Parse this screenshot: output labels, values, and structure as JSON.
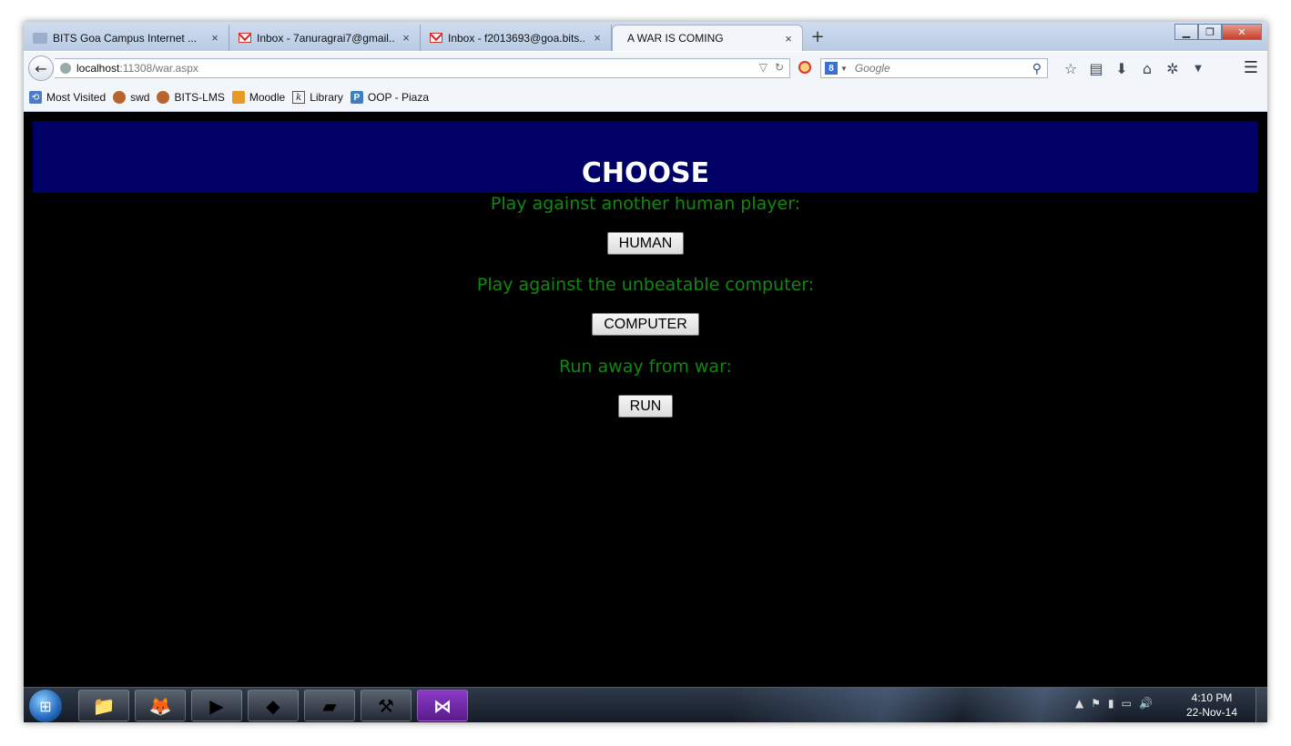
{
  "browser": {
    "tabs": [
      {
        "title": "BITS Goa Campus Internet ...",
        "icon": "network-icon",
        "active": false
      },
      {
        "title": "Inbox - 7anuragrai7@gmail...",
        "icon": "gmail-icon",
        "active": false
      },
      {
        "title": "Inbox - f2013693@goa.bits...",
        "icon": "gmail-icon",
        "active": false
      },
      {
        "title": "A WAR IS COMING",
        "icon": "",
        "active": true
      }
    ],
    "close_glyph": "×",
    "new_tab_glyph": "+",
    "url_host": "localhost",
    "url_path": ":11308/war.aspx",
    "search_engine_glyph": "8",
    "search_placeholder": "Google",
    "bookmarks": [
      {
        "label": "Most Visited",
        "icon": "most-visited-icon"
      },
      {
        "label": "swd",
        "icon": "owl-icon"
      },
      {
        "label": "BITS-LMS",
        "icon": "owl-icon"
      },
      {
        "label": "Moodle",
        "icon": "moodle-icon"
      },
      {
        "label": "Library",
        "icon": "library-icon"
      },
      {
        "label": "OOP - Piaza",
        "icon": "piazza-icon"
      }
    ]
  },
  "page": {
    "title": "CHOOSE",
    "banner_color": "#000066",
    "text_color": "#118811",
    "sections": [
      {
        "prompt": "Play against another human player:",
        "button": "HUMAN"
      },
      {
        "prompt": "Play against the unbeatable computer:",
        "button": "COMPUTER"
      },
      {
        "prompt": "Run away from war:",
        "button": "RUN"
      }
    ]
  },
  "taskbar": {
    "clock_time": "4:10 PM",
    "clock_date": "22-Nov-14",
    "apps": [
      "file-explorer-icon",
      "firefox-icon",
      "media-player-icon",
      "app-icon",
      "notepad-icon",
      "tools-icon",
      "visual-studio-icon"
    ]
  }
}
